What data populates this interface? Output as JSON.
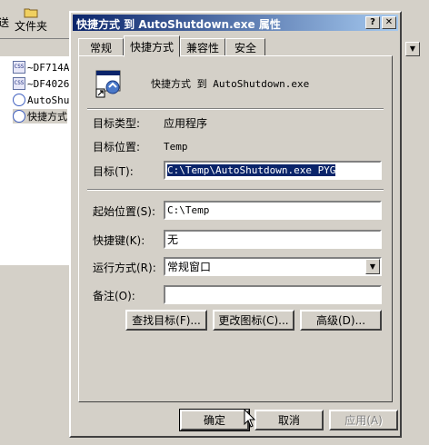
{
  "background": {
    "toolbar": {
      "items": [
        "送",
        "文件夹"
      ]
    },
    "files": [
      "~DF714A",
      "~DF4026",
      "AutoShu",
      "快捷方式"
    ]
  },
  "dialog": {
    "title": "快捷方式 到 AutoShutdown.exe 属性",
    "title_buttons": {
      "help": "?",
      "close": "✕"
    },
    "tabs": [
      "常规",
      "快捷方式",
      "兼容性",
      "安全"
    ],
    "header_name": "快捷方式 到 AutoShutdown.exe",
    "target_type_label": "目标类型:",
    "target_type_value": "应用程序",
    "target_location_label": "目标位置:",
    "target_location_value": "Temp",
    "target_label": "目标(T):",
    "target_value": "C:\\Temp\\AutoShutdown.exe PYG",
    "start_in_label": "起始位置(S):",
    "start_in_value": "C:\\Temp",
    "hotkey_label": "快捷键(K):",
    "hotkey_value": "无",
    "run_label": "运行方式(R):",
    "run_value": "常规窗口",
    "comment_label": "备注(O):",
    "comment_value": "",
    "buttons": {
      "find_target": "查找目标(F)...",
      "change_icon": "更改图标(C)...",
      "advanced": "高级(D)..."
    },
    "footer": {
      "ok": "确定",
      "cancel": "取消",
      "apply": "应用(A)"
    }
  }
}
